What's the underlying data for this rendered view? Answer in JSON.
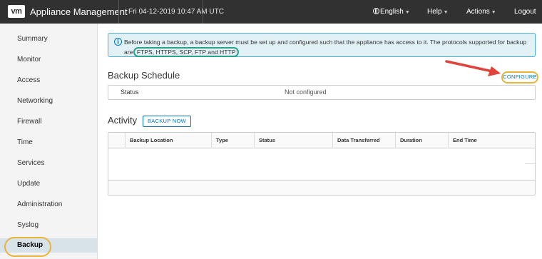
{
  "header": {
    "logo": "vm",
    "app_title": "Appliance Management",
    "datetime": "Fri 04-12-2019 10:47 AM UTC",
    "language": "English",
    "help": "Help",
    "actions": "Actions",
    "logout": "Logout"
  },
  "sidebar": {
    "items": [
      {
        "label": "Summary"
      },
      {
        "label": "Monitor"
      },
      {
        "label": "Access"
      },
      {
        "label": "Networking"
      },
      {
        "label": "Firewall"
      },
      {
        "label": "Time"
      },
      {
        "label": "Services"
      },
      {
        "label": "Update"
      },
      {
        "label": "Administration"
      },
      {
        "label": "Syslog"
      },
      {
        "label": "Backup"
      }
    ],
    "active": "Backup"
  },
  "alert": {
    "text": "Before taking a backup, a backup server must be set up and configured such that the appliance has access to it. The protocols supported for backup are",
    "protocols": "FTPS, HTTPS, SCP, FTP and HTTP"
  },
  "backup_schedule": {
    "title": "Backup Schedule",
    "configure_label": "CONFIGURE",
    "status_label": "Status",
    "status_value": "Not configured"
  },
  "activity": {
    "title": "Activity",
    "backup_now_label": "BACKUP NOW",
    "columns": [
      "Backup Location",
      "Type",
      "Status",
      "Data Transferred",
      "Duration",
      "End Time"
    ],
    "rows": []
  },
  "colors": {
    "header_bg": "#313131",
    "accent": "#0079b8",
    "highlight_oval": "#e8b43a",
    "protocol_oval": "#2aa38a",
    "arrow": "#e0433a"
  },
  "icons": [
    "vmware-logo-icon",
    "globe-icon",
    "info-icon",
    "chevron-down-icon",
    "red-arrow-icon"
  ]
}
